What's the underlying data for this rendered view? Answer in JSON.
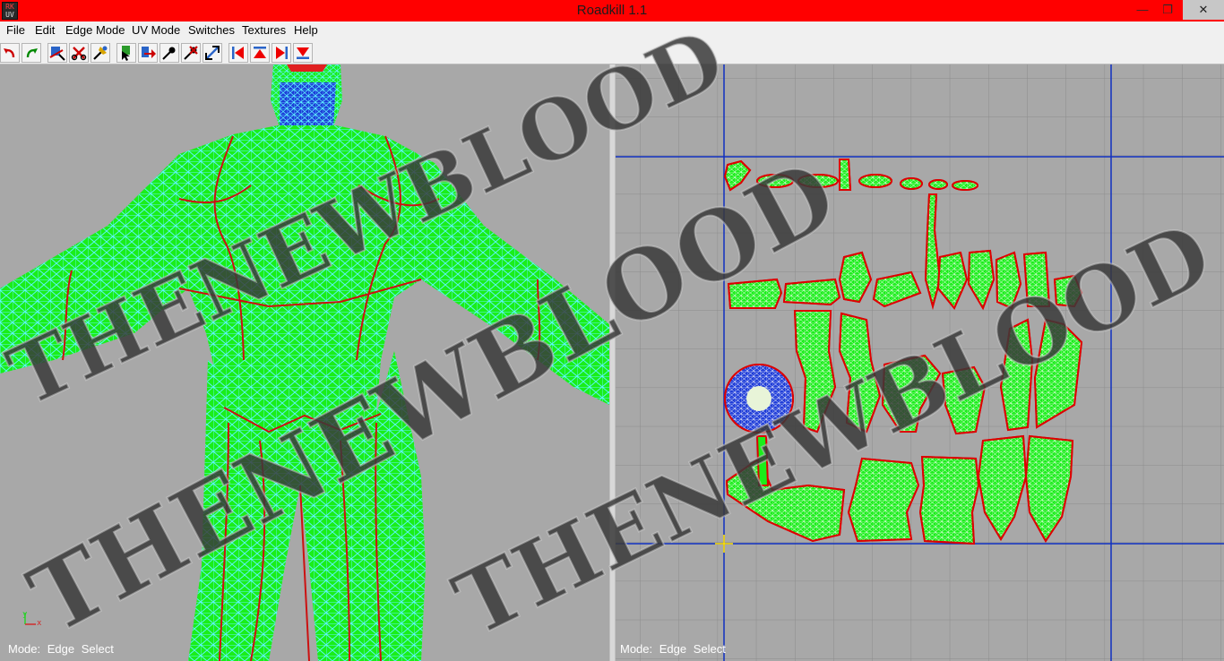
{
  "window": {
    "title": "Roadkill 1.1",
    "icon": "roadkill-app-icon",
    "icon_lines": [
      "RK",
      "UV"
    ],
    "controls": {
      "minimize": "—",
      "maximize": "❐",
      "close": "✕"
    }
  },
  "menu": [
    "File",
    "Edit",
    "Edge Mode",
    "UV Mode",
    "Switches",
    "Textures",
    "Help"
  ],
  "toolbar": [
    {
      "name": "undo-icon"
    },
    {
      "name": "redo-icon"
    },
    {
      "name": "mark-seam-icon"
    },
    {
      "name": "cut-seam-icon"
    },
    {
      "name": "weld-icon"
    },
    {
      "name": "select-edge-icon"
    },
    {
      "name": "select-arrow-icon"
    },
    {
      "name": "pin-icon"
    },
    {
      "name": "unpin-icon"
    },
    {
      "name": "scale-icon"
    },
    {
      "name": "first-icon"
    },
    {
      "name": "up-icon"
    },
    {
      "name": "next-icon"
    },
    {
      "name": "down-icon"
    }
  ],
  "left_view": {
    "status": [
      "Mode:",
      "Edge",
      "Select"
    ],
    "axis_labels": {
      "y": "y",
      "x": "x"
    }
  },
  "right_view": {
    "status": [
      "Mode:",
      "Edge",
      "Select"
    ]
  },
  "watermark": {
    "text": "THENEWBLOOD"
  },
  "colors": {
    "mesh": "#1aee1a",
    "wire": "#5ff5ff",
    "seam": "#cc1111",
    "titlebar": "#ff0000",
    "viewport": "#a8a8a8",
    "uv_border": "#1030c0",
    "watermark": "#3a3a3a"
  }
}
